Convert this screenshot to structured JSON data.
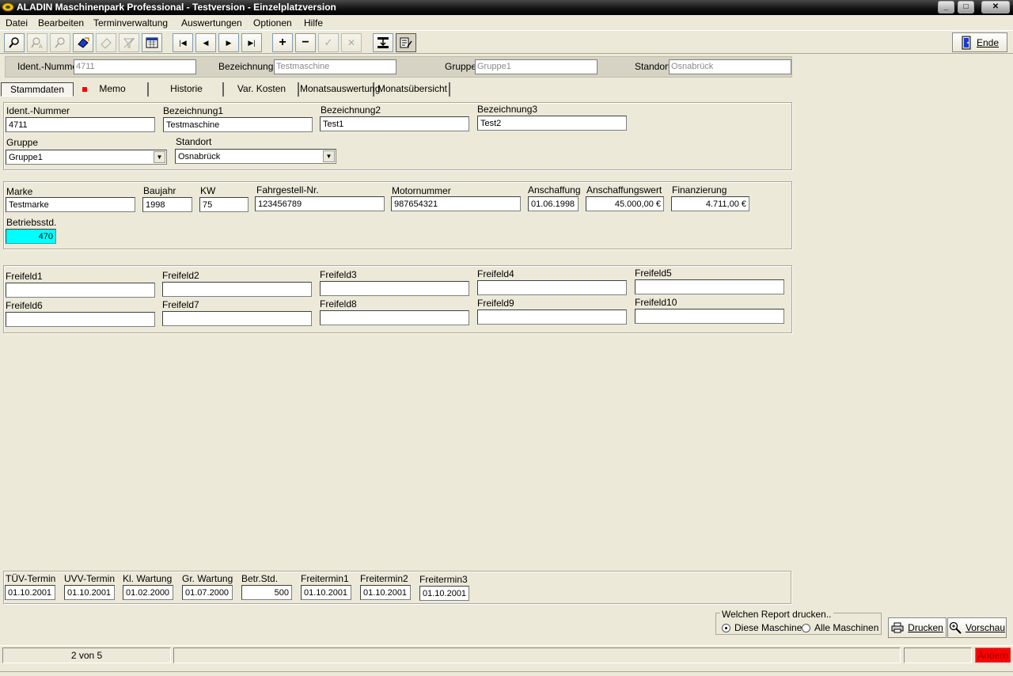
{
  "window": {
    "title": "ALADIN Maschinenpark Professional - Testversion  -  Einzelplatzversion",
    "minimize_glyph": "_",
    "maximize_glyph": "□",
    "close_glyph": "✕"
  },
  "menu": [
    "Datei",
    "Bearbeiten",
    "Terminverwaltung",
    "Auswertungen",
    "Optionen",
    "Hilfe"
  ],
  "toolbar": {
    "icons": [
      "search-icon",
      "find-icon",
      "zoom-icon",
      "edit-icon",
      "erase-icon",
      "filter-icon",
      "calendar-icon",
      "first-record-icon",
      "prev-record-icon",
      "next-record-icon",
      "last-record-icon",
      "add-icon",
      "remove-icon",
      "confirm-icon",
      "cancel-icon",
      "import-icon",
      "form-icon"
    ],
    "first_glyph": "|◀",
    "prev_glyph": "◀",
    "next_glyph": "▶",
    "last_glyph": "▶|",
    "add_glyph": "+",
    "remove_glyph": "−",
    "confirm_glyph": "✓",
    "cancel_glyph": "✕",
    "ende_label": "Ende"
  },
  "info_row": {
    "ident_label": "Ident.-Nummer:",
    "ident_value": "4711",
    "bez1_label": "Bezeichnung1:",
    "bez1_value": "Testmaschine",
    "gruppe_label": "Gruppe:",
    "gruppe_value": "Gruppe1",
    "standort_label": "Standort:",
    "standort_value": "Osnabrück"
  },
  "tabs": [
    "Stammdaten",
    "Memo",
    "Historie",
    "Var. Kosten",
    "Monatsauswertung",
    "Monatsübersicht"
  ],
  "stamm": {
    "ident_label": "Ident.-Nummer",
    "ident_value": "4711",
    "bez1_label": "Bezeichnung1",
    "bez1_value": "Testmaschine",
    "bez2_label": "Bezeichnung2",
    "bez2_value": "Test1",
    "bez3_label": "Bezeichnung3",
    "bez3_value": "Test2",
    "gruppe_label": "Gruppe",
    "gruppe_value": "Gruppe1",
    "standort_label": "Standort",
    "standort_value": "Osnabrück",
    "arrow_glyph": "▼"
  },
  "details": {
    "marke_label": "Marke",
    "marke_value": "Testmarke",
    "baujahr_label": "Baujahr",
    "baujahr_value": "1998",
    "kw_label": "KW",
    "kw_value": "75",
    "fahrgestell_label": "Fahrgestell-Nr.",
    "fahrgestell_value": "123456789",
    "motor_label": "Motornummer",
    "motor_value": "987654321",
    "anschaffung_label": "Anschaffung",
    "anschaffung_value": "01.06.1998",
    "wert_label": "Anschaffungswert",
    "wert_value": "45.000,00 €",
    "finanz_label": "Finanzierung",
    "finanz_value": "4.711,00 €",
    "betrieb_label": "Betriebsstd.",
    "betrieb_value": "470"
  },
  "freifelder": {
    "labels": [
      "Freifeld1",
      "Freifeld2",
      "Freifeld3",
      "Freifeld4",
      "Freifeld5",
      "Freifeld6",
      "Freifeld7",
      "Freifeld8",
      "Freifeld9",
      "Freifeld10"
    ],
    "values": [
      "",
      "",
      "",
      "",
      "",
      "",
      "",
      "",
      "",
      ""
    ]
  },
  "termine": {
    "labels": [
      "TÜV-Termin",
      "UVV-Termin",
      "Kl. Wartung",
      "Gr. Wartung",
      "Betr.Std.",
      "Freitermin1",
      "Freitermin2",
      "Freitermin3"
    ],
    "values": [
      "01.10.2001",
      "01.10.2001",
      "01.02.2000",
      "01.07.2000",
      "500",
      "01.10.2001",
      "01.10.2001",
      "01.10.2001"
    ]
  },
  "report": {
    "legend": "Welchen Report drucken..",
    "option1": "Diese Maschine",
    "option2": "Alle Maschinen",
    "selected": "Diese Maschine",
    "drucken_label": "Drucken",
    "vorschau_label": "Vorschau"
  },
  "status": {
    "record": "2 von 5",
    "message": "",
    "extra": "",
    "mode": "Ändern"
  },
  "colors": {
    "highlight_field": "#00ffff",
    "memo_marker": "#ff0000",
    "mode_badge": "#ff0000"
  }
}
